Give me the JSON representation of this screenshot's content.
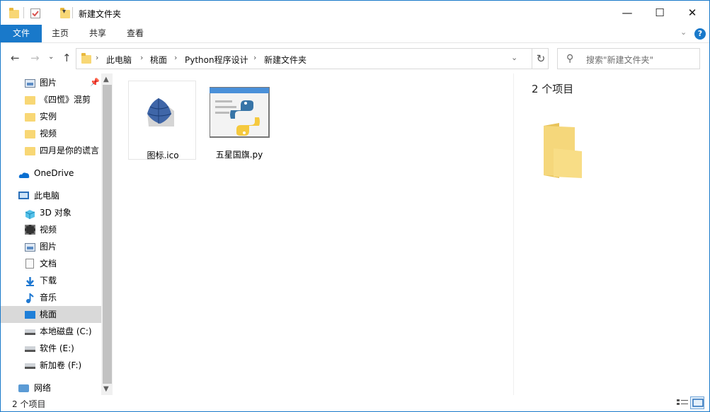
{
  "window": {
    "title": "新建文件夹",
    "accent": "#1979ca"
  },
  "titlebar": {
    "minimize": "—",
    "maximize": "☐",
    "close": "✕"
  },
  "ribbon": {
    "tabs": [
      "文件",
      "主页",
      "共享",
      "查看"
    ]
  },
  "address": {
    "crumbs": [
      "此电脑",
      "桃面",
      "Python程序设计",
      "新建文件夹"
    ],
    "search_placeholder": "搜索\"新建文件夹\""
  },
  "nav": {
    "items": [
      {
        "label": "图片",
        "icon": "pictures-icon",
        "pinned": true
      },
      {
        "label": "《四慌》混剪",
        "icon": "folder-icon"
      },
      {
        "label": "实例",
        "icon": "folder-icon"
      },
      {
        "label": "视频",
        "icon": "folder-icon"
      },
      {
        "label": "四月是你的谎言",
        "icon": "folder-icon"
      },
      {
        "label": "OneDrive",
        "icon": "onedrive-icon"
      },
      {
        "label": "此电脑",
        "icon": "this-pc-icon"
      },
      {
        "label": "3D 对象",
        "icon": "3d-objects-icon"
      },
      {
        "label": "视频",
        "icon": "videos-icon"
      },
      {
        "label": "图片",
        "icon": "pictures-icon"
      },
      {
        "label": "文档",
        "icon": "documents-icon"
      },
      {
        "label": "下载",
        "icon": "downloads-icon"
      },
      {
        "label": "音乐",
        "icon": "music-icon"
      },
      {
        "label": "桃面",
        "icon": "desktop-icon",
        "selected": true
      },
      {
        "label": "本地磁盘 (C:)",
        "icon": "drive-icon"
      },
      {
        "label": "软件 (E:)",
        "icon": "drive-icon"
      },
      {
        "label": "新加卷 (F:)",
        "icon": "drive-icon"
      },
      {
        "label": "网络",
        "icon": "network-icon"
      }
    ]
  },
  "files": [
    {
      "name": "图标.ico",
      "icon": "ico-file-icon"
    },
    {
      "name": "五星国旗.py",
      "icon": "python-file-icon"
    }
  ],
  "preview": {
    "title": "2 个项目"
  },
  "status": {
    "text": "2 个项目"
  }
}
